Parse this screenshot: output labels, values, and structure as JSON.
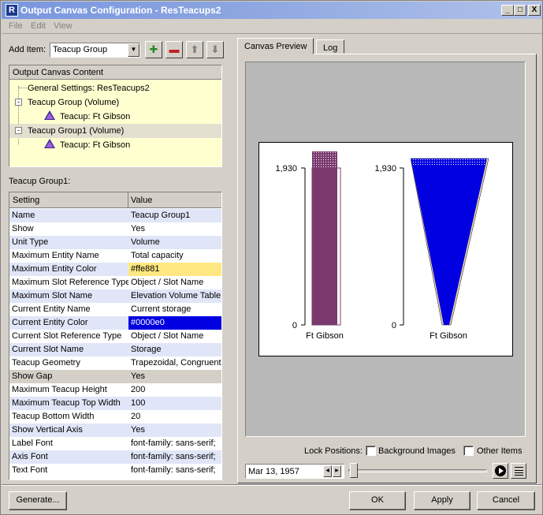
{
  "window": {
    "title": "Output Canvas Configuration - ResTeacups2",
    "app_icon": "R",
    "controls": [
      "_",
      "□",
      "X"
    ]
  },
  "menu": [
    "File",
    "Edit",
    "View"
  ],
  "add_item": {
    "label": "Add Item:",
    "value": "Teacup Group"
  },
  "tree": {
    "header": "Output Canvas Content",
    "items": [
      {
        "label": "General Settings: ResTeacups2"
      },
      {
        "label": "Teacup Group (Volume)"
      },
      {
        "label": "Teacup: Ft Gibson"
      },
      {
        "label": "Teacup Group1 (Volume)"
      },
      {
        "label": "Teacup: Ft Gibson"
      }
    ]
  },
  "properties": {
    "section_label": "Teacup Group1:",
    "col_setting": "Setting",
    "col_value": "Value",
    "rows": [
      {
        "setting": "Name",
        "value": "Teacup Group1"
      },
      {
        "setting": "Show",
        "value": "Yes"
      },
      {
        "setting": "Unit Type",
        "value": "Volume"
      },
      {
        "setting": "Maximum Entity Name",
        "value": "Total capacity"
      },
      {
        "setting": "Maximum Entity Color",
        "value": "#ffe881",
        "swatch": "#ffe881"
      },
      {
        "setting": "Maximum Slot Reference Type",
        "value": "Object / Slot Name"
      },
      {
        "setting": "Maximum Slot Name",
        "value": "Elevation Volume Table"
      },
      {
        "setting": "Current Entity Name",
        "value": "Current storage"
      },
      {
        "setting": "Current Entity Color",
        "value": "#0000e0",
        "swatch": "#0000e0"
      },
      {
        "setting": "Current Slot Reference Type",
        "value": "Object / Slot Name"
      },
      {
        "setting": "Current Slot Name",
        "value": "Storage"
      },
      {
        "setting": "Teacup Geometry",
        "value": "Trapezoidal, Congruent"
      },
      {
        "setting": "Show Gap",
        "value": "Yes"
      },
      {
        "setting": "Maximum Teacup Height",
        "value": "200"
      },
      {
        "setting": "Maximum Teacup Top Width",
        "value": "100"
      },
      {
        "setting": "Teacup Bottom Width",
        "value": "20"
      },
      {
        "setting": "Show Vertical Axis",
        "value": "Yes"
      },
      {
        "setting": "Label Font",
        "value": "font-family: sans-serif;"
      },
      {
        "setting": "Axis Font",
        "value": "font-family: sans-serif;"
      },
      {
        "setting": "Text Font",
        "value": "font-family: sans-serif;"
      }
    ]
  },
  "tabs": [
    "Canvas Preview",
    "Log"
  ],
  "preview": {
    "teacups": [
      {
        "label": "Ft Gibson",
        "axis_max": "1,930",
        "axis_min": "0",
        "fill_color": "#7a3a6e",
        "cap_color": "#7a3a6e"
      },
      {
        "label": "Ft Gibson",
        "axis_max": "1,930",
        "axis_min": "0",
        "fill_color": "#0000e0",
        "cap_color": "#0000e0"
      }
    ]
  },
  "lock": {
    "label": "Lock Positions:",
    "background_images": "Background Images",
    "other_items": "Other Items"
  },
  "date": "Mar 13, 1957",
  "buttons": {
    "generate": "Generate...",
    "ok": "OK",
    "apply": "Apply",
    "cancel": "Cancel"
  }
}
